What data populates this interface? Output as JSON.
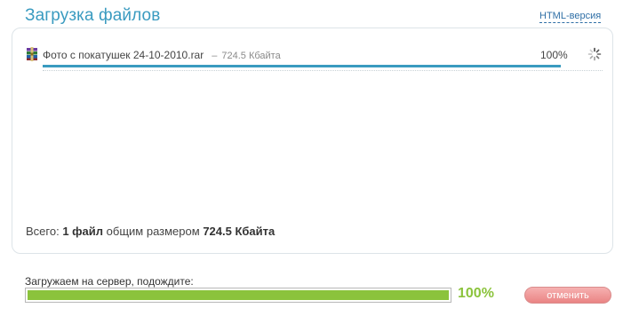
{
  "header": {
    "title": "Загрузка файлов",
    "html_version_link": "HTML-версия"
  },
  "files": [
    {
      "name": "Фото с покатушек 24-10-2010.rar",
      "separator": "–",
      "size": "724.5 Кбайта",
      "percent_text": "100%",
      "progress": 1.0,
      "icon": "winrar-archive-icon",
      "status_icon": "loading-spinner-icon"
    }
  ],
  "summary": {
    "prefix": "Всего:",
    "count": "1 файл",
    "middle": "общим размером",
    "total_size": "724.5 Кбайта"
  },
  "upload": {
    "label": "Загружаем на сервер, подождите:",
    "percent_text": "100%",
    "progress": 1.0,
    "cancel_label": "отменить"
  },
  "colors": {
    "accent": "#3a9bc0",
    "progress_green": "#8bc33c",
    "cancel_button": "#ea8484"
  }
}
